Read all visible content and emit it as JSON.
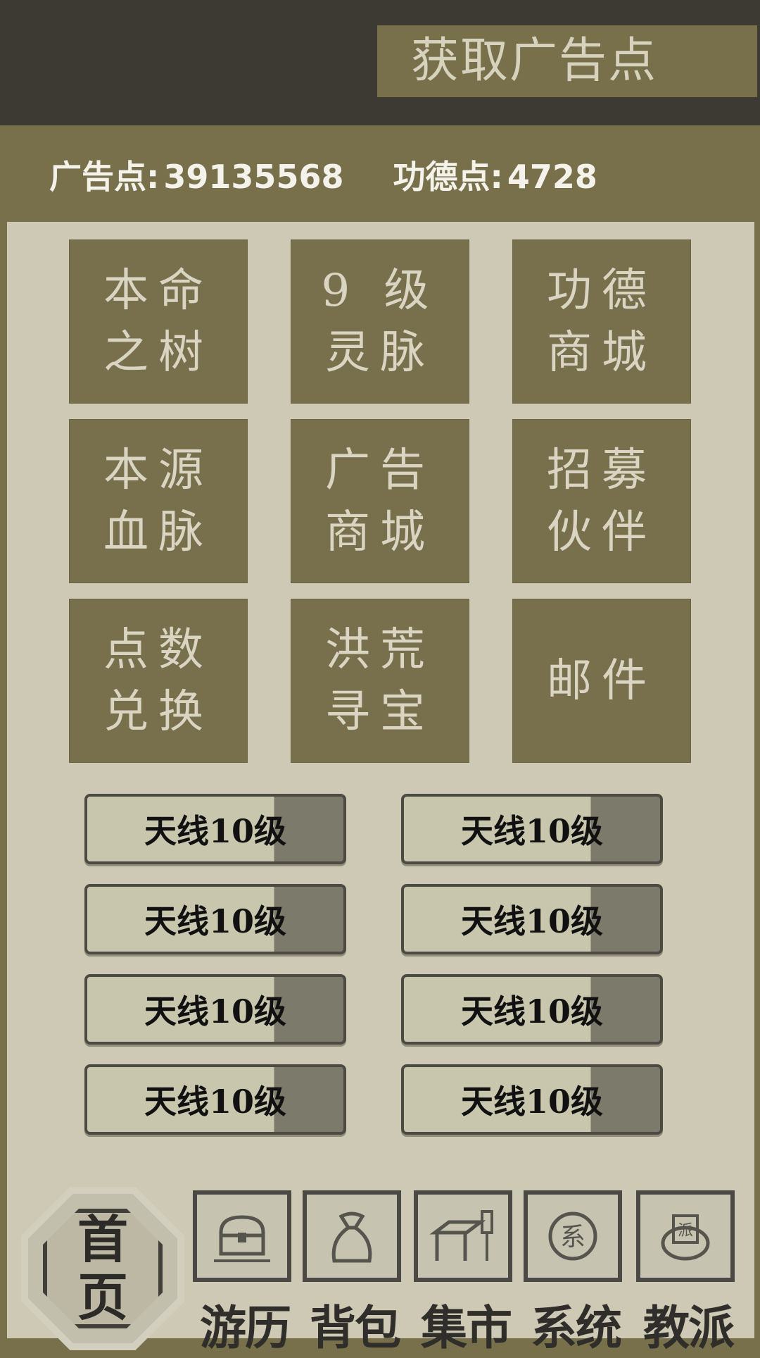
{
  "header": {
    "get_ad_points": "获取广告点"
  },
  "stats": {
    "ad_label": "广告点:",
    "ad_value": "39135568",
    "merit_label": "功德点:",
    "merit_value": "4728"
  },
  "tiles": [
    "本命之树",
    "9 级灵脉",
    "功德商城",
    "本源血脉",
    "广告商城",
    "招募伙伴",
    "点数兑换",
    "洪荒寻宝",
    "邮件"
  ],
  "level_buttons": [
    "天线10级",
    "天线10级",
    "天线10级",
    "天线10级",
    "天线10级",
    "天线10级",
    "天线10级",
    "天线10级"
  ],
  "nav": {
    "home_line1": "首",
    "home_line2": "页",
    "items": [
      "游历",
      "背包",
      "集市",
      "系统",
      "教派"
    ],
    "icons": [
      "chest-icon",
      "bag-icon",
      "table-icon",
      "system-seal-icon",
      "sect-seal-icon"
    ]
  },
  "colors": {
    "topbar": "#3c3a33",
    "accent": "#77704b",
    "panel": "#cdc9b5"
  }
}
